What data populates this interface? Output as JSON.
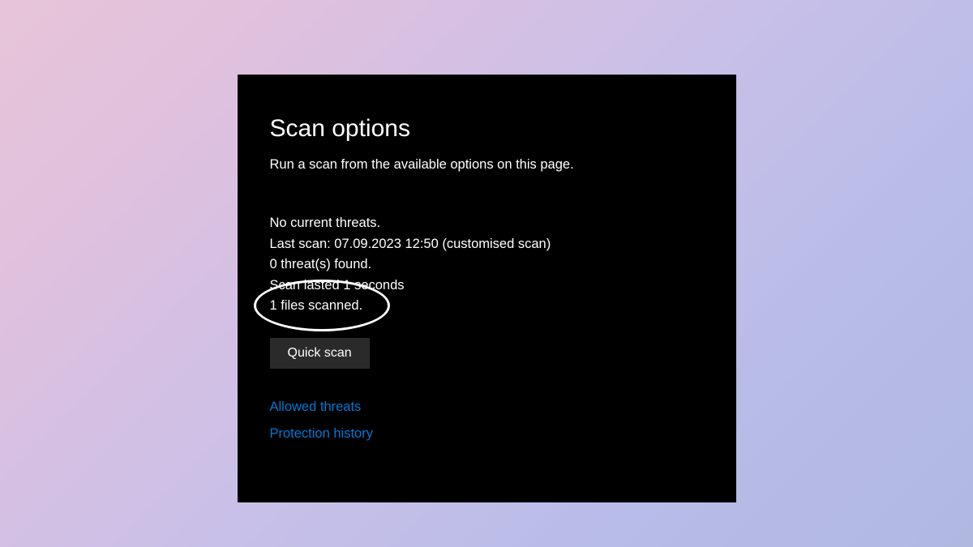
{
  "header": {
    "title": "Scan options",
    "subtitle": "Run a scan from the available options on this page."
  },
  "status": {
    "no_threats": "No current threats.",
    "last_scan": "Last scan: 07.09.2023 12:50 (customised scan)",
    "threats_found": "0 threat(s) found.",
    "scan_duration": "Scan lasted 1 seconds",
    "files_scanned": "1 files scanned."
  },
  "actions": {
    "quick_scan_label": "Quick scan"
  },
  "links": {
    "allowed_threats": "Allowed threats",
    "protection_history": "Protection history"
  }
}
